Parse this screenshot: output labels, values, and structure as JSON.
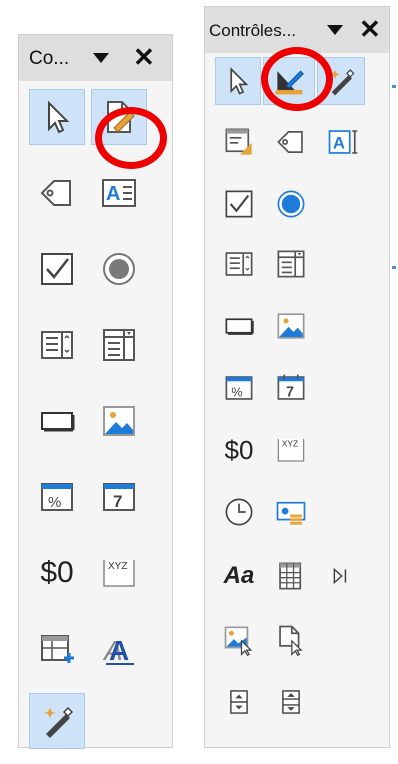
{
  "left_panel": {
    "title": "Co...",
    "icons": [
      "select-cursor-icon",
      "design-mode-icon",
      "label-icon",
      "text-box-icon",
      "checkbox-icon",
      "option-button-icon",
      "list-box-icon",
      "combo-box-icon",
      "push-button-icon",
      "image-button-icon",
      "formatted-field-icon",
      "date-field-icon",
      "currency-field-icon",
      "pattern-field-icon",
      "table-control-icon",
      "font-work-icon",
      "wizards-icon"
    ],
    "currency_text": "$0",
    "pattern_text": "XYZ",
    "date_text": "7",
    "aa_text": "A"
  },
  "right_panel": {
    "title": "Contrôles...",
    "icons": [
      "select-cursor-icon",
      "design-mode-icon",
      "wizards-icon",
      "form-design-icon",
      "label-icon",
      "text-box-icon",
      "checkbox-icon",
      "option-button-icon",
      "list-box-icon",
      "combo-box-icon",
      "push-button-icon",
      "image-button-icon",
      "formatted-field-icon",
      "date-field-icon",
      "currency-field-icon",
      "pattern-field-icon",
      "time-field-icon",
      "numeric-field-icon",
      "font-aa-icon",
      "table-control-icon",
      "navigation-bar-icon",
      "image-control-icon",
      "file-selection-icon",
      "spin-button-icon",
      "scroll-bar-icon"
    ],
    "currency_text": "$0",
    "pattern_text": "XYZ",
    "date_text": "7",
    "aa_text": "Aa"
  },
  "colors": {
    "highlight": "#cfe3f8",
    "ring": "#ee0000",
    "accent": "#1f7bd8"
  }
}
